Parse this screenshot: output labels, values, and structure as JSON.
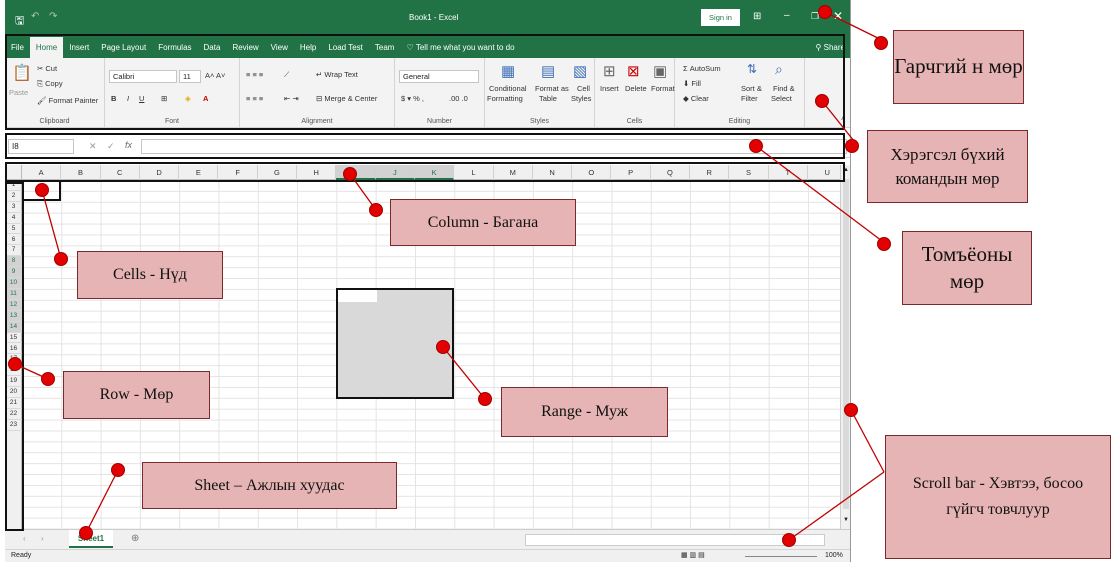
{
  "excel": {
    "quick_access": [
      "H",
      "↶",
      "↷",
      "="
    ],
    "window_title": "Book1 - Excel",
    "sign_in": "Sign in",
    "tabs": [
      "File",
      "Home",
      "Insert",
      "Page Layout",
      "Formulas",
      "Data",
      "Review",
      "View",
      "Help",
      "Load Test",
      "Team"
    ],
    "tell_me": "Tell me what you want to do",
    "share": "Share",
    "ribbon": {
      "clipboard": {
        "paste": "Paste",
        "cut": "Cut",
        "copy": "Copy",
        "format_painter": "Format Painter",
        "label": "Clipboard"
      },
      "font": {
        "name": "Calibri",
        "size": "11",
        "label": "Font"
      },
      "alignment": {
        "wrap": "Wrap Text",
        "merge": "Merge & Center",
        "label": "Alignment"
      },
      "number": {
        "format": "General",
        "label": "Number"
      },
      "styles": {
        "conditional": "Conditional",
        "formatting": "Formatting",
        "format_as": "Format as",
        "table": "Table",
        "cell": "Cell",
        "cell_styles": "Styles",
        "label": "Styles"
      },
      "cells": {
        "insert": "Insert",
        "delete": "Delete",
        "format": "Format",
        "label": "Cells"
      },
      "editing": {
        "autosum": "AutoSum",
        "fill": "Fill",
        "clear": "Clear",
        "sort": "Sort &",
        "filter": "Filter",
        "find": "Find &",
        "select": "Select",
        "label": "Editing"
      }
    },
    "name_box": "I8",
    "fx": "fx",
    "columns": [
      "A",
      "B",
      "C",
      "D",
      "E",
      "F",
      "G",
      "H",
      "I",
      "J",
      "K",
      "L",
      "M",
      "N",
      "O",
      "P",
      "Q",
      "R",
      "S",
      "T",
      "U"
    ],
    "rows": [
      "1",
      "2",
      "3",
      "4",
      "5",
      "6",
      "7",
      "8",
      "9",
      "10",
      "11",
      "12",
      "13",
      "14",
      "15",
      "16",
      "17",
      "18",
      "19",
      "20",
      "21",
      "22",
      "23"
    ],
    "sheet_tab": "Sheet1",
    "add_sheet": "⊕",
    "status": "Ready",
    "zoom": "100%"
  },
  "annotations": {
    "title_row": "Гарчгий н мөр",
    "ribbon_row": "Хэрэгсэл бүхий командын мөр",
    "formula_row": "Томъёоны мөр",
    "column": "Column - Багана",
    "cells": "Cells - Нүд",
    "row": "Row - Мөр",
    "range": "Range - Муж",
    "sheet": "Sheet – Ажлын хуудас",
    "scroll": "Scroll bar - Хэвтээ, босоо гүйгч товчлуур"
  },
  "colors": {
    "excel_green": "#217346",
    "callout_fill": "#e6b4b4",
    "dot_red": "#e30000"
  }
}
